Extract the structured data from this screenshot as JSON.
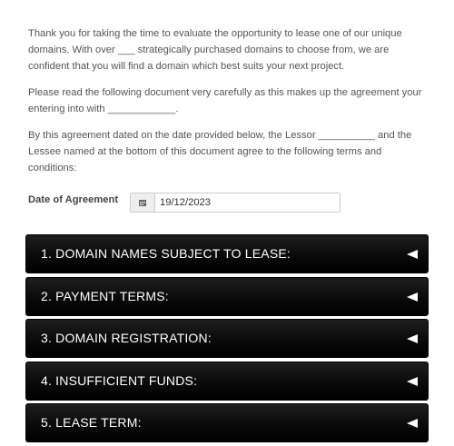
{
  "intro": {
    "paragraph1": "Thank you for taking the time to evaluate the opportunity to lease one of our unique domains. With over ___ strategically purchased domains to choose from, we are confident that you will find a domain which best suits your next project.",
    "paragraph2": "Please read the following document very carefully as this makes up the agreement your entering into with ____________.",
    "paragraph3": "By this agreement dated on the date provided below, the Lessor __________ and the Lessee named at the bottom of this document agree to the following terms and conditions:"
  },
  "date_field": {
    "label": "Date of Agreement",
    "value": "19/12/2023",
    "icon": "calendar-icon"
  },
  "sections": [
    {
      "title": "1. DOMAIN NAMES SUBJECT TO LEASE:"
    },
    {
      "title": "2. PAYMENT TERMS:"
    },
    {
      "title": "3. DOMAIN REGISTRATION:"
    },
    {
      "title": "4. INSUFFICIENT FUNDS:"
    },
    {
      "title": "5. LEASE TERM:"
    }
  ],
  "colors": {
    "text": "#555555",
    "accordion_bg": "#000000",
    "accordion_text": "#ffffff"
  }
}
